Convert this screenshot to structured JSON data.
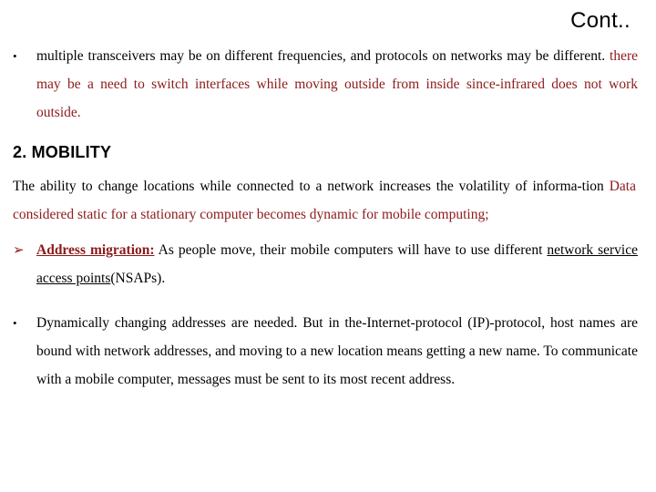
{
  "slide": {
    "title": "Cont..",
    "bullet_glyphs": {
      "dot": "•",
      "arrow": "➢"
    },
    "blocks": {
      "bullet1": {
        "segment_black_1": "multiple transceivers may be on different frequencies, and protocols on networks may be different. ",
        "segment_red_1": "there may be a need to switch interfaces while moving outside from inside since-infrared does not  work  outside."
      },
      "section_heading": "2. MOBILITY",
      "para1": {
        "segment_black_1": "The ability  to  change  locations  while  connected  to  a  network  increases  the volatility  of  informa-tion ",
        "segment_red_1": "Data considered static   for   a  stationary   computer becomes dynamic for  mobile  computing;"
      },
      "bullet2": {
        "label_red_underlined": "Address migration:",
        "segment_black_1": " As people move, their mobile computers will have to use different  ",
        "segment_black_underlined": "network service access points",
        "segment_black_2": "(NSAPs)."
      },
      "bullet3": {
        "segment_black_1": "Dynamically changing addresses are needed. But in the-Internet-protocol (IP)-protocol, host names are bound with network addresses, and moving to a new location means getting a new name. To communicate with a mobile computer, messages must be sent to its most recent address."
      }
    }
  },
  "colors": {
    "accent_red": "#8C1A1A",
    "text_black": "#000000",
    "background": "#FFFFFF"
  }
}
